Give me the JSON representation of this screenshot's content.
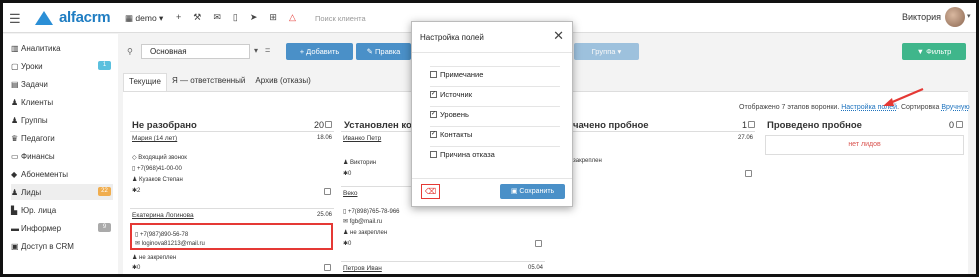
{
  "topbar": {
    "logo": "alfacrm",
    "demo_label": "demo",
    "search_placeholder": "Поиск клиента",
    "user_name": "Виктория"
  },
  "sidebar": {
    "items": [
      {
        "label": "Аналитика",
        "icon": "chart-icon"
      },
      {
        "label": "Уроки",
        "icon": "calendar-icon",
        "badge": "1",
        "badge_color": "#5bc0de"
      },
      {
        "label": "Задачи",
        "icon": "tasks-icon"
      },
      {
        "label": "Клиенты",
        "icon": "user-icon"
      },
      {
        "label": "Группы",
        "icon": "users-icon"
      },
      {
        "label": "Педагоги",
        "icon": "teacher-icon"
      },
      {
        "label": "Финансы",
        "icon": "money-icon"
      },
      {
        "label": "Абонементы",
        "icon": "tag-icon"
      },
      {
        "label": "Лиды",
        "icon": "leads-icon",
        "badge": "22",
        "badge_color": "#f0ad4e"
      },
      {
        "label": "Юр. лица",
        "icon": "building-icon"
      },
      {
        "label": "Информер",
        "icon": "informer-icon",
        "badge": "9",
        "badge_color": "#aaaaaa"
      },
      {
        "label": "Доступ в CRM",
        "icon": "lock-icon"
      }
    ]
  },
  "toolbar": {
    "filter_value": "Основная",
    "add_label": "+ Добавить",
    "edit_label": "✎ Правка",
    "group_label": "Группа",
    "filter_label": "▼ Фильтр",
    "colors": {
      "blue": "#4a90c8",
      "green": "#3fb68b"
    }
  },
  "tabs": [
    "Текущие",
    "Я — ответственный",
    "Архив (отказы)"
  ],
  "info": {
    "prefix": "Отображено 7 этапов воронки.",
    "settings_link": "Настройка полей",
    "sort_label": "Сортировка",
    "sort_value": "Вручную"
  },
  "columns": [
    {
      "title": "Не разобрано",
      "count": "20"
    },
    {
      "title": "Установлен кон",
      "count": ""
    },
    {
      "title": "чачено пробное",
      "count": "1"
    },
    {
      "title": "Проведено пробное",
      "count": "0"
    }
  ],
  "cards": {
    "c1": {
      "name": "Мария (14 лет)",
      "date": "18.06",
      "source": "Входящий звонок",
      "phone": "+7(968)41-00-00",
      "manager": "Кузаков Степан",
      "tasks": "2"
    },
    "c2": {
      "name": "Екатерина Логинова",
      "date": "25.06",
      "phone": "+7(987)890-56-78",
      "email": "loginova81213@mail.ru",
      "manager": "не закреплен",
      "tasks": "0"
    },
    "c3": {
      "name": "Иванко Петр",
      "date": "",
      "manager": "Викторин",
      "tasks": "0"
    },
    "c4": {
      "name": "Веко",
      "phone": "+7(898)765-78-966",
      "email": "fgb@mail.ru",
      "manager": "не закреплен",
      "tasks": "0"
    },
    "c5": {
      "name": "Петров Иван",
      "date": "05.04"
    },
    "c6": {
      "date": "27.06",
      "manager": "закреплен"
    },
    "no_leads": "нет лидов"
  },
  "modal": {
    "title": "Настройка полей",
    "fields": [
      {
        "label": "Примечание",
        "checked": false
      },
      {
        "label": "Источник",
        "checked": true
      },
      {
        "label": "Уровень",
        "checked": true
      },
      {
        "label": "Контакты",
        "checked": true
      },
      {
        "label": "Причина отказа",
        "checked": false
      }
    ],
    "save_label": "Сохранить"
  },
  "accent": {
    "red": "#e53935",
    "link": "#1e73be"
  }
}
